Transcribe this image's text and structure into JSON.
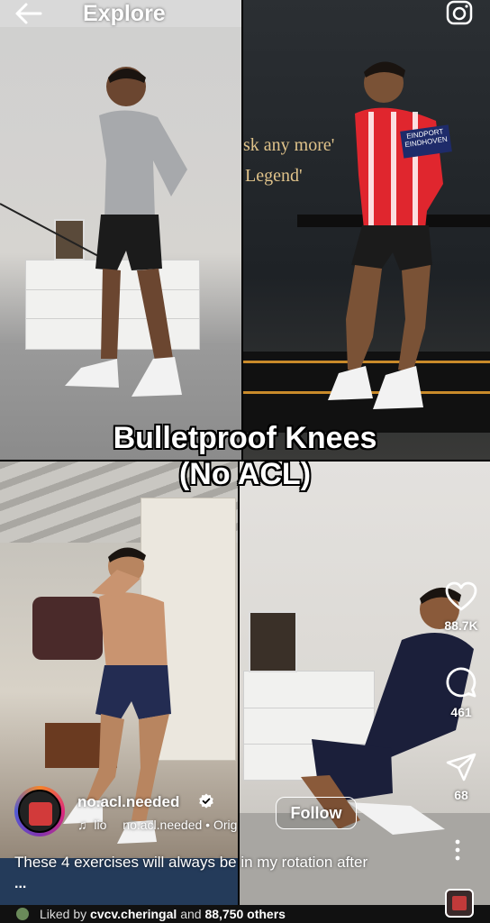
{
  "header": {
    "title": "Explore"
  },
  "video": {
    "overlay_line1": "Bulletproof Knees",
    "overlay_line2": "(No ACL)",
    "sign_line1": "sk any more'",
    "sign_line2": "Legend'",
    "jersey_text": "EINDPORT EINDHOVEN"
  },
  "actions": {
    "likes": "88.7K",
    "comments": "461",
    "shares": "68"
  },
  "author": {
    "username": "no.acl.needed",
    "follow_label": "Follow",
    "audio_prefix": "lio",
    "audio_source": "no.acl.needed • Orig"
  },
  "caption": {
    "text": "These 4 exercises will always be in my rotation after",
    "more": "..."
  },
  "liked_by": {
    "prefix": "Liked by",
    "user": "cvcv.cheringal",
    "and": "and",
    "others": "88,750 others"
  },
  "colors": {
    "accent": "#ffffff",
    "background": "#000000",
    "verified": "#ffffff"
  }
}
